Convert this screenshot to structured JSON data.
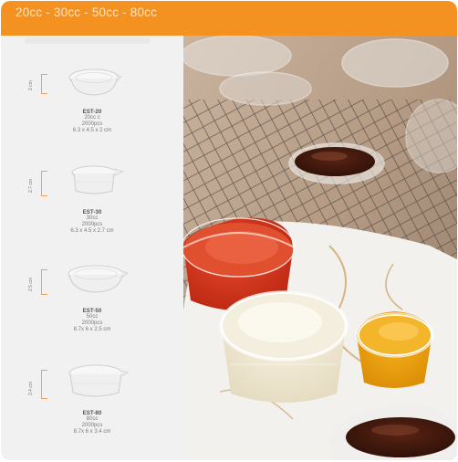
{
  "header": {
    "title": "20cc - 30cc - 50cc - 80cc"
  },
  "products": [
    {
      "code": "EST-20",
      "volume": "20cc c",
      "pack": "2000pcs",
      "size": "6.3 x 4.5 x 2 cm",
      "height_label": "2 cm"
    },
    {
      "code": "EST-30",
      "volume": "30cc",
      "pack": "2000pcs",
      "size": "6.3 x 4.5 x 2.7 cm",
      "height_label": "2.7 cm"
    },
    {
      "code": "EST-50",
      "volume": "50cc",
      "pack": "2000pcs",
      "size": "8.7x 6 x 2.5 cm",
      "height_label": "2.5 cm"
    },
    {
      "code": "EST-80",
      "volume": "80cc",
      "pack": "2000pcs",
      "size": "8.7x 6 x 3.4 cm",
      "height_label": "3.4 cm"
    }
  ],
  "colors": {
    "accent": "#f39220",
    "dimension_line": "#f3a24a",
    "panel": "#f1f1f1"
  }
}
